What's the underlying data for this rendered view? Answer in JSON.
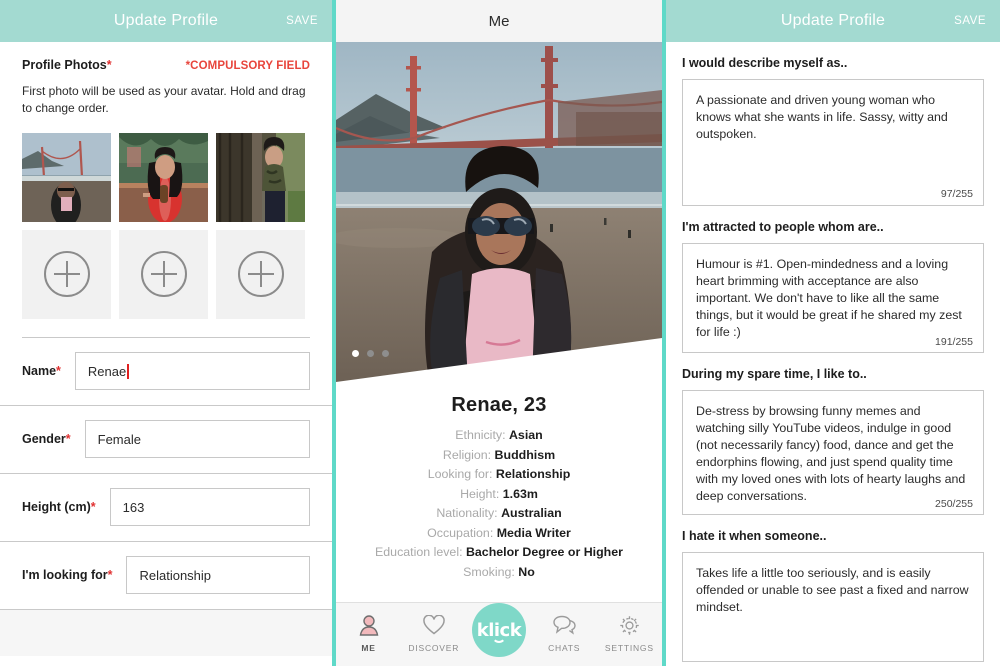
{
  "left_panel": {
    "header": {
      "title": "Update Profile",
      "save_label": "SAVE"
    },
    "photos_section": {
      "label": "Profile Photos",
      "required_marker": "*",
      "compulsory_note": "*COMPULSORY FIELD",
      "helper_text": "First photo will be used as your avatar. Hold and drag to change order.",
      "filled_photos": [
        {
          "alt": "woman-at-beach-with-golden-gate-bridge"
        },
        {
          "alt": "woman-in-red-top-with-drink-at-cafe"
        },
        {
          "alt": "woman-in-camo-jacket-by-tree"
        }
      ],
      "add_slots": 3,
      "add_icon": "plus-icon"
    },
    "fields": [
      {
        "label": "Name",
        "required_marker": "*",
        "value": "Renae",
        "has_caret": true
      },
      {
        "label": "Gender",
        "required_marker": "*",
        "value": "Female",
        "has_caret": false
      },
      {
        "label": "Height (cm)",
        "required_marker": "*",
        "value": "163",
        "has_caret": false
      },
      {
        "label": "I'm looking for",
        "required_marker": "*",
        "value": "Relationship",
        "has_caret": false
      }
    ]
  },
  "middle_panel": {
    "header": {
      "title": "Me"
    },
    "carousel": {
      "total_dots": 3,
      "active_index": 0
    },
    "profile": {
      "name_age": "Renae, 23",
      "attributes": [
        {
          "key": "Ethnicity:",
          "value": "Asian"
        },
        {
          "key": "Religion:",
          "value": "Buddhism"
        },
        {
          "key": "Looking for:",
          "value": "Relationship"
        },
        {
          "key": "Height:",
          "value": "1.63m"
        },
        {
          "key": "Nationality:",
          "value": "Australian"
        },
        {
          "key": "Occupation:",
          "value": "Media Writer"
        },
        {
          "key": "Education level:",
          "value": "Bachelor Degree or Higher"
        },
        {
          "key": "Smoking:",
          "value": "No"
        }
      ]
    },
    "tabbar": {
      "tabs": [
        {
          "label": "ME",
          "icon": "person-icon",
          "active": true
        },
        {
          "label": "DISCOVER",
          "icon": "heart-icon",
          "active": false
        },
        {
          "label": "",
          "icon": "klick-logo-icon",
          "active": false,
          "brand_text": "klick"
        },
        {
          "label": "CHATS",
          "icon": "speech-bubbles-icon",
          "active": false
        },
        {
          "label": "SETTINGS",
          "icon": "gear-icon",
          "active": false
        }
      ]
    }
  },
  "right_panel": {
    "header": {
      "title": "Update Profile",
      "save_label": "SAVE"
    },
    "questions": [
      {
        "label": "I would describe myself as..",
        "value": "A passionate and driven young woman who knows what she wants in life. Sassy, witty and outspoken.",
        "counter": "97/255"
      },
      {
        "label": "I'm attracted to people whom are..",
        "value": "Humour is #1. Open-mindedness and a loving heart brimming with acceptance are also important. We don't have to like all the same things, but it would be great if he shared my zest for life :)",
        "counter": "191/255"
      },
      {
        "label": "During my spare time, I like to..",
        "value": "De-stress by browsing funny memes and watching silly YouTube videos, indulge in good (not necessarily fancy) food, dance and get the endorphins flowing, and just spend quality time with my loved ones with lots of hearty laughs and deep conversations.",
        "counter": "250/255"
      },
      {
        "label": "I hate it when someone..",
        "value": "Takes life a little too seriously, and is easily offended or unable to see past a fixed and narrow mindset.",
        "counter": ""
      }
    ]
  },
  "colors": {
    "header_teal": "#a3dad1",
    "divider_teal": "#5fd9c8",
    "brand_teal": "#7fd8c8",
    "required_red": "#e03030",
    "compulsory_red": "#e8453c",
    "caret_red": "#e02020",
    "active_tab_pink": "#f2b9bc"
  }
}
